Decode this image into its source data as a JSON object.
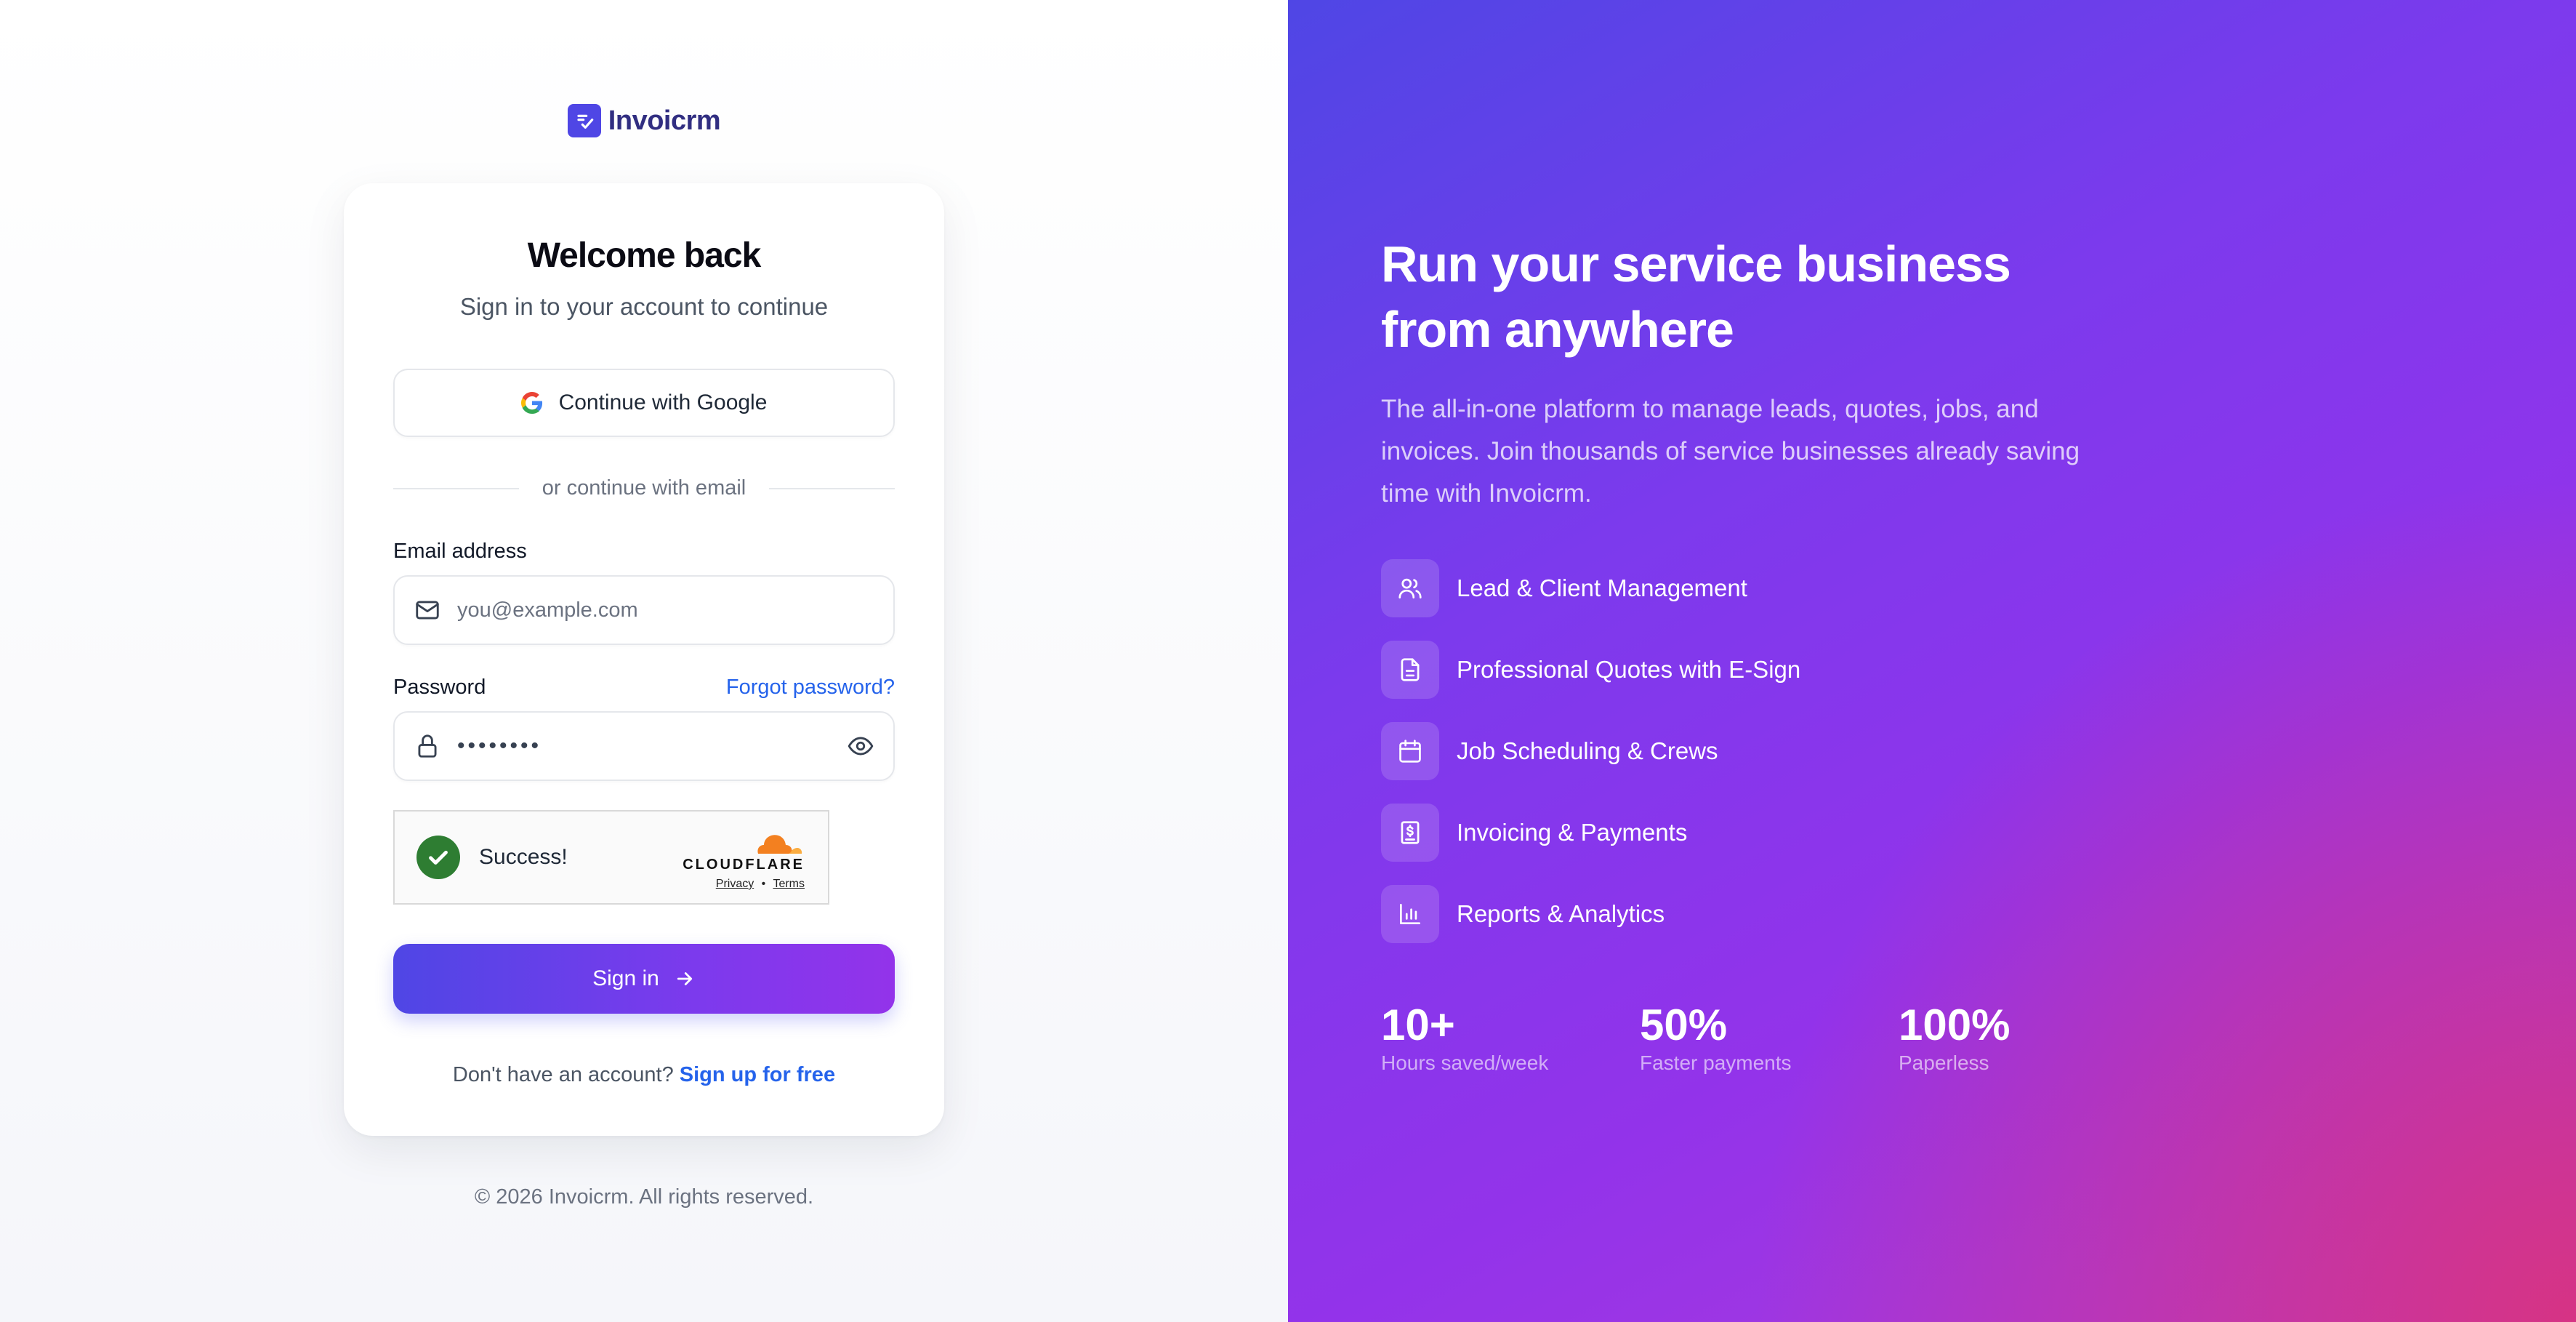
{
  "brand": {
    "name": "Invoicrm",
    "accent": "#4f46e5",
    "link_color": "#2563eb"
  },
  "login": {
    "title": "Welcome back",
    "subtitle": "Sign in to your account to continue",
    "google_label": "Continue with Google",
    "divider_text": "or continue with email",
    "email_label": "Email address",
    "email_placeholder": "you@example.com",
    "password_label": "Password",
    "forgot_label": "Forgot password?",
    "password_value": "••••••••",
    "captcha": {
      "status": "Success!",
      "provider": "CLOUDFLARE",
      "privacy": "Privacy",
      "separator": "•",
      "terms": "Terms"
    },
    "signin_label": "Sign in",
    "signup_prompt": "Don't have an account?",
    "signup_link": "Sign up for free"
  },
  "footer": {
    "copyright": "© 2026 Invoicrm. All rights reserved."
  },
  "hero": {
    "title_line1": "Run your service business",
    "title_line2": "from anywhere",
    "description": "The all-in-one platform to manage leads, quotes, jobs, and invoices. Join thousands of service businesses already saving time with Invoicrm.",
    "features": [
      {
        "icon": "users-icon",
        "label": "Lead & Client Management"
      },
      {
        "icon": "document-icon",
        "label": "Professional Quotes with E-Sign"
      },
      {
        "icon": "calendar-icon",
        "label": "Job Scheduling & Crews"
      },
      {
        "icon": "invoice-dollar-icon",
        "label": "Invoicing & Payments"
      },
      {
        "icon": "bar-chart-icon",
        "label": "Reports & Analytics"
      }
    ],
    "stats": [
      {
        "value": "10+",
        "label": "Hours saved/week"
      },
      {
        "value": "50%",
        "label": "Faster payments"
      },
      {
        "value": "100%",
        "label": "Paperless"
      }
    ]
  }
}
